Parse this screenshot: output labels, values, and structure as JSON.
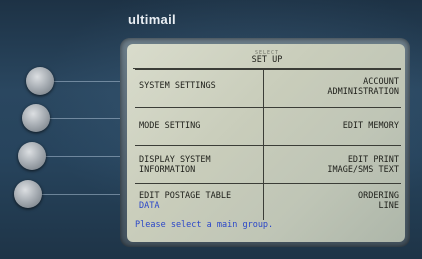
{
  "brand": "ultimail",
  "screen": {
    "top_label": "SELECT",
    "title": "SET UP",
    "menu": {
      "left": [
        {
          "label": "SYSTEM SETTINGS",
          "line2": ""
        },
        {
          "label": "MODE SETTING",
          "line2": ""
        },
        {
          "label": "DISPLAY SYSTEM",
          "line2": "INFORMATION"
        },
        {
          "label": "EDIT POSTAGE TABLE",
          "line2": "DATA"
        }
      ],
      "right": [
        {
          "label": "ACCOUNT",
          "line2": "ADMINISTRATION"
        },
        {
          "label": "EDIT MEMORY",
          "line2": ""
        },
        {
          "label": "EDIT PRINT",
          "line2": "IMAGE/SMS TEXT"
        },
        {
          "label": "ORDERING",
          "line2": "LINE"
        }
      ]
    },
    "status": "Please select a main group."
  },
  "colors": {
    "lcd_text": "#1e1f1a",
    "lcd_highlight": "#2a46c8",
    "body": "#2a4760"
  }
}
